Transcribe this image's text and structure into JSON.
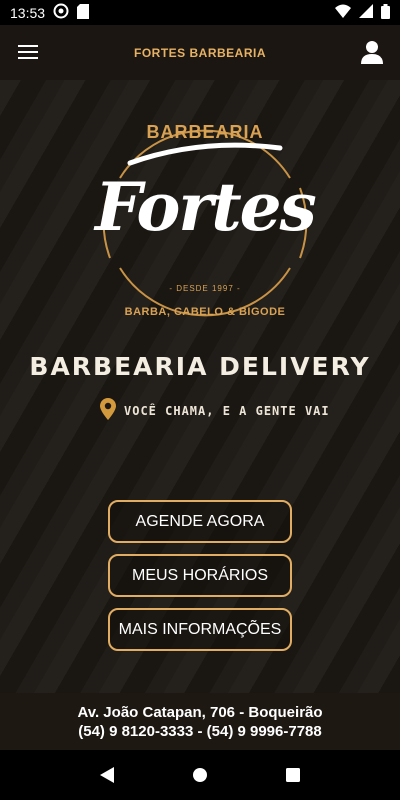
{
  "status_bar": {
    "time": "13:53",
    "icons": [
      "at-sign-icon",
      "sd-card-icon",
      "wifi-icon",
      "signal-icon",
      "battery-icon"
    ]
  },
  "app_bar": {
    "title": "FORTES BARBEARIA",
    "menu_icon": "hamburger-menu-icon",
    "profile_icon": "user-profile-icon"
  },
  "logo": {
    "top_text": "BARBEARIA",
    "script_text": "Fortes",
    "since_text": "- DESDE 1997 -",
    "bottom_text": "BARBA, CABELO & BIGODE"
  },
  "hero": {
    "headline": "BARBEARIA DELIVERY",
    "tagline": "VOCÊ CHAMA, E A GENTE VAI",
    "tagline_icon": "location-pin-icon"
  },
  "buttons": {
    "schedule": "AGENDE AGORA",
    "my_times": "MEUS HORÁRIOS",
    "more_info": "MAIS INFORMAÇÕES"
  },
  "footer": {
    "address": "Av. João Catapan, 706 - Boqueirão",
    "phones": "(54) 9 8120-3333 - (54) 9 9996-7788"
  },
  "colors": {
    "accent": "#e1ad62",
    "background": "#1c1814",
    "footer_bg": "#1e1813"
  }
}
